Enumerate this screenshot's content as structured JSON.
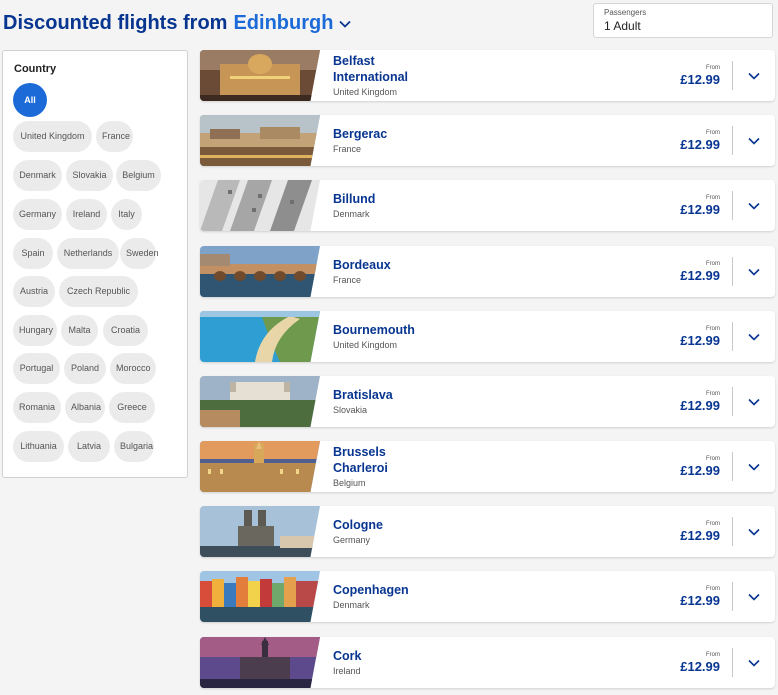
{
  "header": {
    "title": "Discounted flights from",
    "origin": "Edinburgh"
  },
  "passengers": {
    "label": "Passengers",
    "value": "1 Adult"
  },
  "filter": {
    "heading": "Country",
    "chips": [
      "All",
      "United Kingdom",
      "France",
      "Denmark",
      "Slovakia",
      "Belgium",
      "Germany",
      "Ireland",
      "Italy",
      "Spain",
      "Netherlands",
      "Sweden",
      "Austria",
      "Czech Republic",
      "Hungary",
      "Malta",
      "Croatia",
      "Portugal",
      "Poland",
      "Morocco",
      "Romania",
      "Albania",
      "Greece",
      "Lithuania",
      "Latvia",
      "Bulgaria"
    ],
    "active": "All"
  },
  "colors": {
    "brand_navy": "#073590",
    "accent_blue": "#1c6ad8",
    "page_bg": "#f4f4f4"
  },
  "destinations": [
    {
      "name_lines": [
        "Belfast",
        "International"
      ],
      "country": "United Kingdom",
      "from_label": "From",
      "price": "£12.99",
      "image": "belfast-city-hall-photo"
    },
    {
      "name_lines": [
        "Bergerac"
      ],
      "country": "France",
      "from_label": "From",
      "price": "£12.99",
      "image": "bergerac-riverside-photo"
    },
    {
      "name_lines": [
        "Billund"
      ],
      "country": "Denmark",
      "from_label": "From",
      "price": "£12.99",
      "image": "billund-building-photo"
    },
    {
      "name_lines": [
        "Bordeaux"
      ],
      "country": "France",
      "from_label": "From",
      "price": "£12.99",
      "image": "bordeaux-bridge-photo"
    },
    {
      "name_lines": [
        "Bournemouth"
      ],
      "country": "United Kingdom",
      "from_label": "From",
      "price": "£12.99",
      "image": "bournemouth-coast-photo"
    },
    {
      "name_lines": [
        "Bratislava"
      ],
      "country": "Slovakia",
      "from_label": "From",
      "price": "£12.99",
      "image": "bratislava-castle-photo"
    },
    {
      "name_lines": [
        "Brussels",
        "Charleroi"
      ],
      "country": "Belgium",
      "from_label": "From",
      "price": "£12.99",
      "image": "brussels-grand-place-photo"
    },
    {
      "name_lines": [
        "Cologne"
      ],
      "country": "Germany",
      "from_label": "From",
      "price": "£12.99",
      "image": "cologne-cathedral-photo"
    },
    {
      "name_lines": [
        "Copenhagen"
      ],
      "country": "Denmark",
      "from_label": "From",
      "price": "£12.99",
      "image": "copenhagen-nyhavn-photo"
    },
    {
      "name_lines": [
        "Cork"
      ],
      "country": "Ireland",
      "from_label": "From",
      "price": "£12.99",
      "image": "cork-church-photo"
    }
  ]
}
